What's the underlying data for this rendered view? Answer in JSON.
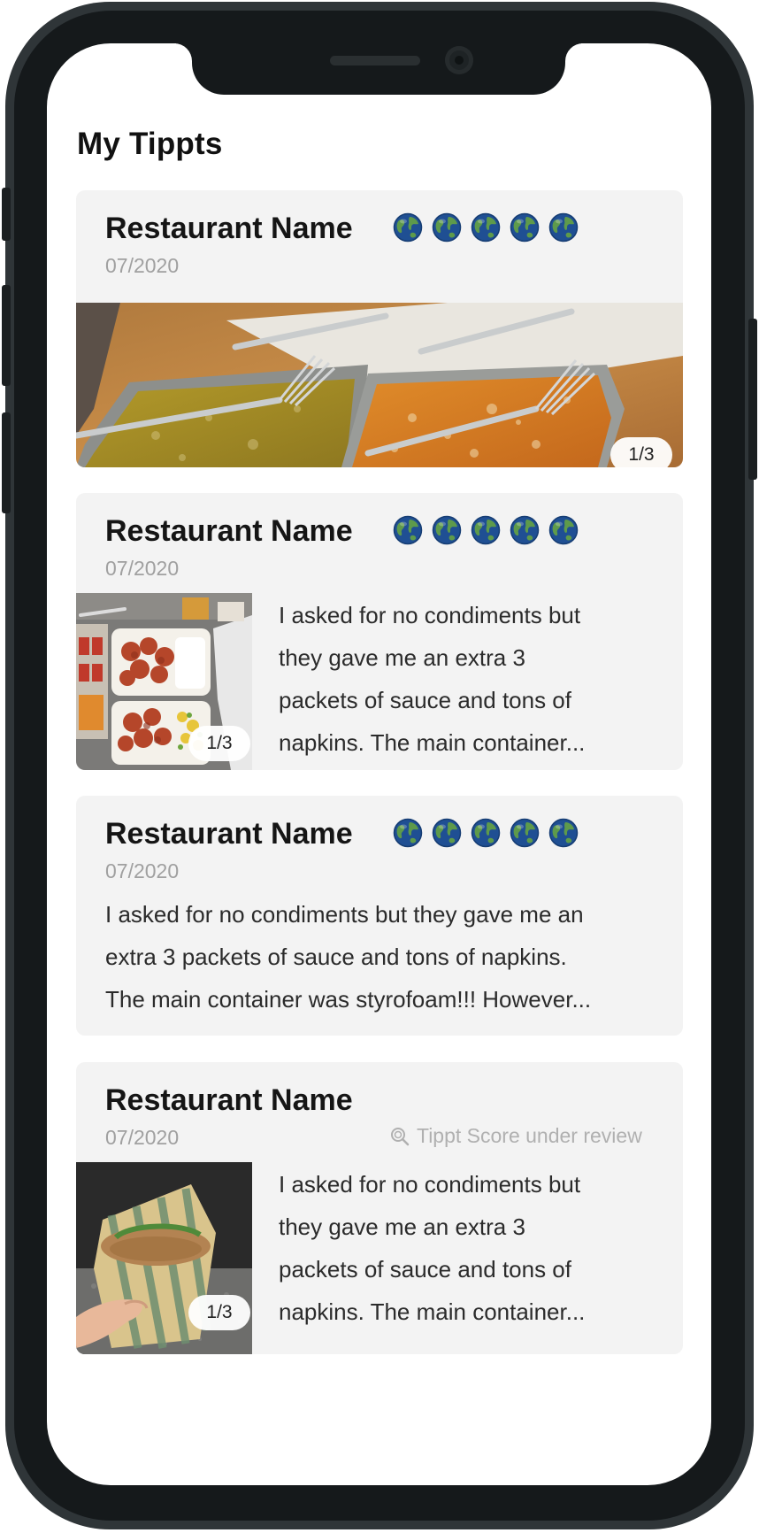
{
  "app": {
    "title": "My Tippts"
  },
  "colors": {
    "card_bg": "#f3f3f3",
    "globe_blue": "#1f4f93",
    "globe_land": "#4a8a3f",
    "muted_text": "#a0a0a0"
  },
  "cards": [
    {
      "name": "Restaurant Name",
      "date": "07/2020",
      "rating": 5,
      "rating_icon": "globe-icon",
      "photo_counter": "1/3",
      "photo_subject": "food-trays-with-forks"
    },
    {
      "name": "Restaurant Name",
      "date": "07/2020",
      "rating": 5,
      "rating_icon": "globe-icon",
      "photo_counter": "1/3",
      "photo_subject": "orange-chicken-takeout",
      "text_lines": [
        "I asked for no condiments but",
        "they gave me an extra 3",
        "packets of sauce and tons of",
        "napkins. The main container..."
      ]
    },
    {
      "name": "Restaurant Name",
      "date": "07/2020",
      "rating": 5,
      "rating_icon": "globe-icon",
      "text_lines": [
        "I asked for no condiments but they gave me an",
        "extra 3 packets of sauce and tons of napkins.",
        "The main container was styrofoam!!! However..."
      ]
    },
    {
      "name": "Restaurant Name",
      "date": "07/2020",
      "review_status": "Tippt Score under review",
      "review_icon": "magnify-globe-icon",
      "photo_counter": "1/3",
      "photo_subject": "wrapped-sandwich",
      "text_lines": [
        "I asked for no condiments but",
        "they gave me an extra 3",
        "packets of sauce and tons of",
        "napkins. The main container..."
      ]
    }
  ]
}
